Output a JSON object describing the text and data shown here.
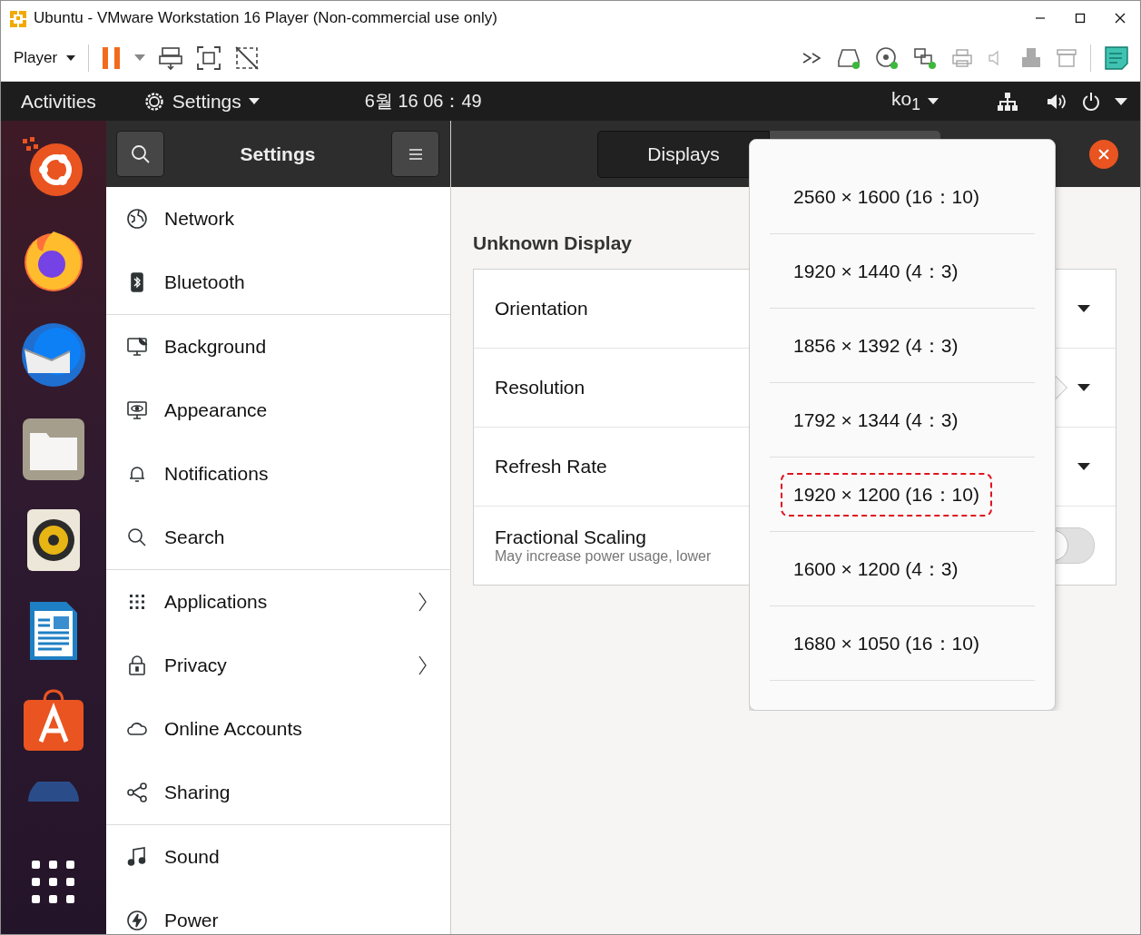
{
  "window": {
    "title": "Ubuntu - VMware Workstation 16 Player (Non-commercial use only)"
  },
  "toolbar": {
    "menu": "Player"
  },
  "topbar": {
    "activities": "Activities",
    "app_menu": "Settings",
    "clock": "6월 16 06：49",
    "input_source": "ko$_{1}$"
  },
  "settings_header": {
    "title": "Settings"
  },
  "sidebar": {
    "groups": [
      {
        "items": [
          {
            "label": "Network",
            "has_submenu": false
          },
          {
            "label": "Bluetooth",
            "has_submenu": false
          }
        ]
      },
      {
        "items": [
          {
            "label": "Background",
            "has_submenu": false
          },
          {
            "label": "Appearance",
            "has_submenu": false
          },
          {
            "label": "Notifications",
            "has_submenu": false
          },
          {
            "label": "Search",
            "has_submenu": false
          }
        ]
      },
      {
        "items": [
          {
            "label": "Applications",
            "has_submenu": true
          },
          {
            "label": "Privacy",
            "has_submenu": true
          },
          {
            "label": "Online Accounts",
            "has_submenu": false
          },
          {
            "label": "Sharing",
            "has_submenu": false
          }
        ]
      },
      {
        "items": [
          {
            "label": "Sound",
            "has_submenu": false
          },
          {
            "label": "Power",
            "has_submenu": false
          }
        ]
      }
    ]
  },
  "main": {
    "tabs": [
      {
        "label": "Displays",
        "selected": true
      }
    ],
    "section_title": "Unknown Display",
    "rows": [
      {
        "kind": "dropdown",
        "label": "Orientation"
      },
      {
        "kind": "dropdown",
        "label": "Resolution"
      },
      {
        "kind": "dropdown",
        "label": "Refresh Rate"
      },
      {
        "kind": "switch",
        "label": "Fractional Scaling",
        "subtitle": "May increase power usage, lower",
        "on": false
      }
    ]
  },
  "popover": {
    "items": [
      {
        "label": "2560 × 1600 (16：10)",
        "highlighted": false
      },
      {
        "label": "1920 × 1440 (4：3)",
        "highlighted": false
      },
      {
        "label": "1856 × 1392 (4：3)",
        "highlighted": false
      },
      {
        "label": "1792 × 1344 (4：3)",
        "highlighted": false
      },
      {
        "label": "1920 × 1200 (16：10)",
        "highlighted": true
      },
      {
        "label": "1600 × 1200 (4：3)",
        "highlighted": false
      },
      {
        "label": "1680 × 1050 (16：10)",
        "highlighted": false
      }
    ]
  }
}
